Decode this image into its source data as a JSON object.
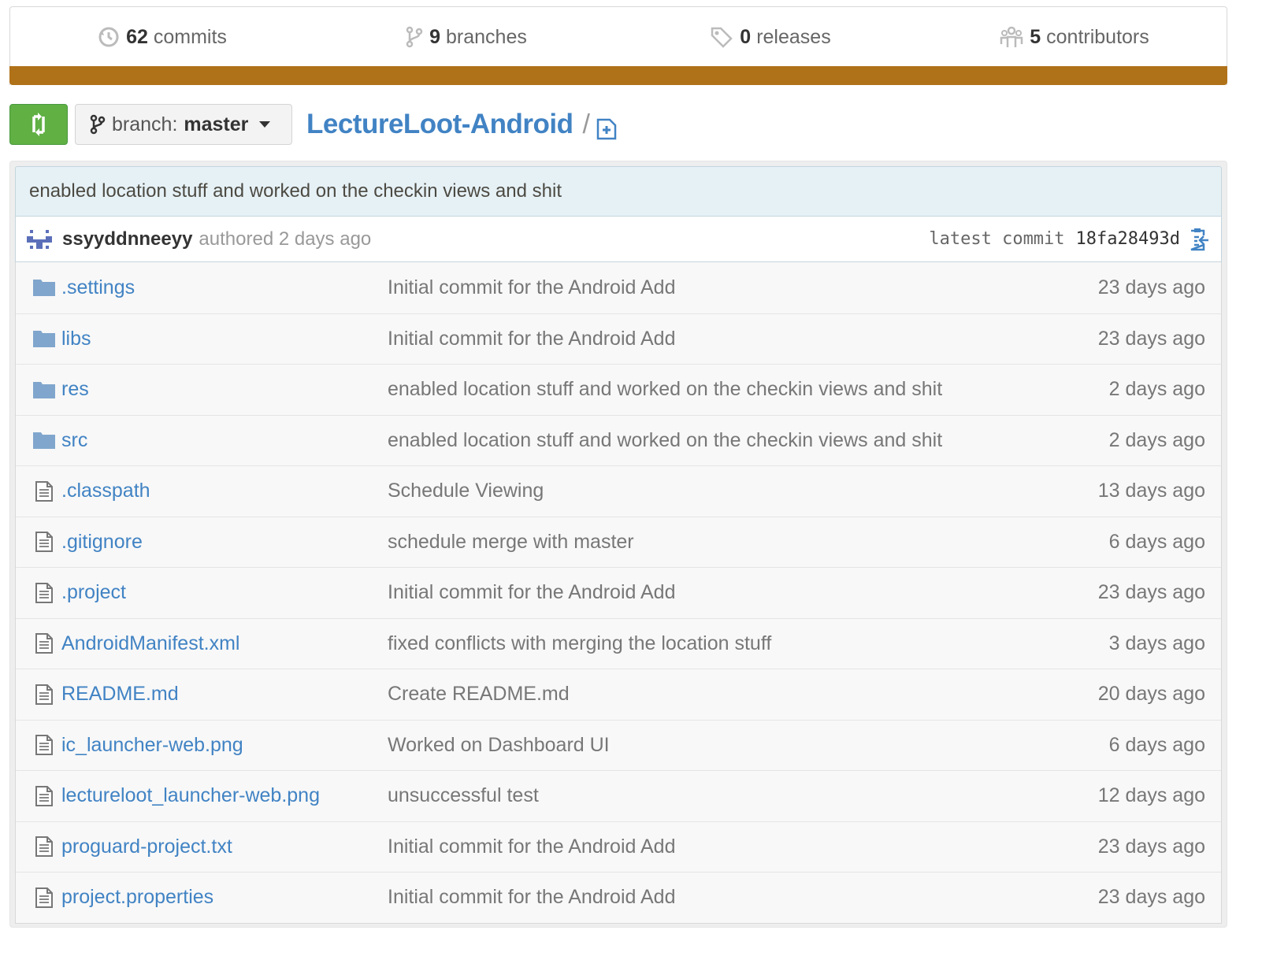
{
  "stats": {
    "commits": {
      "num": "62",
      "label": "commits",
      "icon": "history-icon"
    },
    "branches": {
      "num": "9",
      "label": "branches",
      "icon": "branch-icon"
    },
    "releases": {
      "num": "0",
      "label": "releases",
      "icon": "tag-icon"
    },
    "contributors": {
      "num": "5",
      "label": "contributors",
      "icon": "organization-icon"
    }
  },
  "language_bar": {
    "color": "#b07219"
  },
  "toolbar": {
    "compare_icon": "compare-icon",
    "branch_label": "branch:",
    "branch_name": "master",
    "repo_name": "LectureLoot-Android",
    "separator": "/",
    "new_file_icon": "new-file-icon"
  },
  "latest_commit": {
    "message": "enabled location stuff and worked on the checkin views and shit",
    "author": "ssyyddnneeyy",
    "authored": "authored 2 days ago",
    "latest_label": "latest commit",
    "sha": "18fa28493d"
  },
  "files": [
    {
      "type": "dir",
      "name": ".settings",
      "message": "Initial commit for the Android Add",
      "age": "23 days ago"
    },
    {
      "type": "dir",
      "name": "libs",
      "message": "Initial commit for the Android Add",
      "age": "23 days ago"
    },
    {
      "type": "dir",
      "name": "res",
      "message": "enabled location stuff and worked on the checkin views and shit",
      "age": "2 days ago"
    },
    {
      "type": "dir",
      "name": "src",
      "message": "enabled location stuff and worked on the checkin views and shit",
      "age": "2 days ago"
    },
    {
      "type": "file",
      "name": ".classpath",
      "message": "Schedule Viewing",
      "age": "13 days ago"
    },
    {
      "type": "file",
      "name": ".gitignore",
      "message": "schedule merge with master",
      "age": "6 days ago"
    },
    {
      "type": "file",
      "name": ".project",
      "message": "Initial commit for the Android Add",
      "age": "23 days ago"
    },
    {
      "type": "file",
      "name": "AndroidManifest.xml",
      "message": "fixed conflicts with merging the location stuff",
      "age": "3 days ago"
    },
    {
      "type": "file",
      "name": "README.md",
      "message": "Create README.md",
      "age": "20 days ago"
    },
    {
      "type": "file",
      "name": "ic_launcher-web.png",
      "message": "Worked on Dashboard UI",
      "age": "6 days ago"
    },
    {
      "type": "file",
      "name": "lectureloot_launcher-web.png",
      "message": "unsuccessful test",
      "age": "12 days ago"
    },
    {
      "type": "file",
      "name": "proguard-project.txt",
      "message": "Initial commit for the Android Add",
      "age": "23 days ago"
    },
    {
      "type": "file",
      "name": "project.properties",
      "message": "Initial commit for the Android Add",
      "age": "23 days ago"
    }
  ]
}
